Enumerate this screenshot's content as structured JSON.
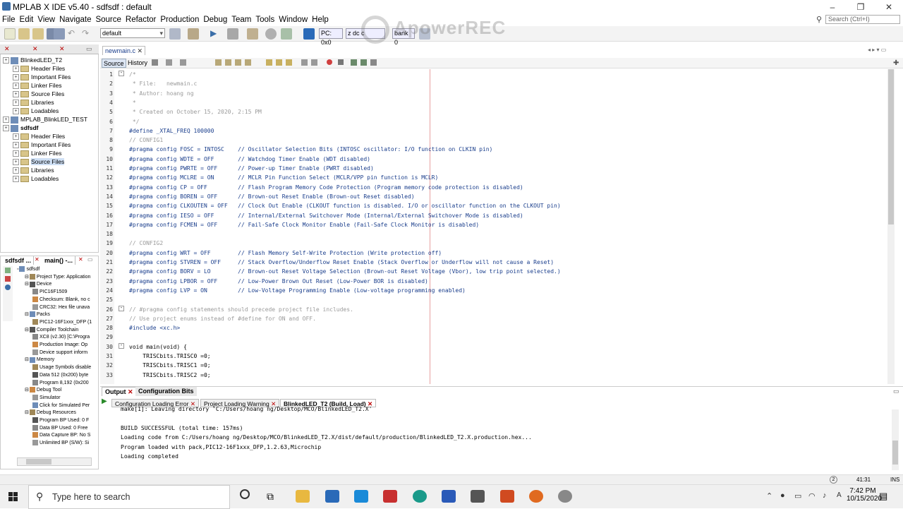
{
  "window": {
    "title": "MPLAB X IDE v5.40 - sdfsdf : default",
    "minimize": "–",
    "restore": "❐",
    "close": "✕"
  },
  "menu": [
    "File",
    "Edit",
    "View",
    "Navigate",
    "Source",
    "Refactor",
    "Production",
    "Debug",
    "Team",
    "Tools",
    "Window",
    "Help"
  ],
  "search": {
    "placeholder": "Search (Ctrl+I)"
  },
  "toolbar": {
    "config": "default",
    "pc": "PC: 0x0",
    "z": "z dc c",
    "bank": "bank 0",
    "watermark": "ApowerREC"
  },
  "projects": {
    "tabs": [
      "",
      "",
      ""
    ],
    "items": [
      {
        "label": "BlinkedLED_T2",
        "level": 0,
        "type": "project",
        "sel": false
      },
      {
        "label": "Header Files",
        "level": 1,
        "type": "folder"
      },
      {
        "label": "Important Files",
        "level": 1,
        "type": "folder"
      },
      {
        "label": "Linker Files",
        "level": 1,
        "type": "folder"
      },
      {
        "label": "Source Files",
        "level": 1,
        "type": "folder"
      },
      {
        "label": "Libraries",
        "level": 1,
        "type": "folder"
      },
      {
        "label": "Loadables",
        "level": 1,
        "type": "folder"
      },
      {
        "label": "MPLAB_BlinkLED_TEST",
        "level": 0,
        "type": "project"
      },
      {
        "label": "sdfsdf",
        "level": 0,
        "type": "project",
        "bold": true
      },
      {
        "label": "Header Files",
        "level": 1,
        "type": "folder"
      },
      {
        "label": "Important Files",
        "level": 1,
        "type": "folder"
      },
      {
        "label": "Linker Files",
        "level": 1,
        "type": "folder"
      },
      {
        "label": "Source Files",
        "level": 1,
        "type": "folder",
        "sel": true
      },
      {
        "label": "Libraries",
        "level": 1,
        "type": "folder"
      },
      {
        "label": "Loadables",
        "level": 1,
        "type": "folder"
      }
    ]
  },
  "dashboard": {
    "tabs": [
      "sdfsdf ...",
      "main() -..."
    ],
    "items": [
      {
        "label": "sdfsdf",
        "lvl": 0
      },
      {
        "label": "Project Type: Application",
        "lvl": 1
      },
      {
        "label": "Device",
        "lvl": 1
      },
      {
        "label": "PIC16F1509",
        "lvl": 2
      },
      {
        "label": "Checksum: Blank, no c",
        "lvl": 2
      },
      {
        "label": "CRC32: Hex file unava",
        "lvl": 2
      },
      {
        "label": "Packs",
        "lvl": 1
      },
      {
        "label": "PIC12-16F1xxx_DFP (1",
        "lvl": 2
      },
      {
        "label": "Compiler Toolchain",
        "lvl": 1
      },
      {
        "label": "XC8 (v2.30) [C:\\Progra",
        "lvl": 2
      },
      {
        "label": "Production Image: Op",
        "lvl": 2
      },
      {
        "label": "Device support inform",
        "lvl": 2
      },
      {
        "label": "Memory",
        "lvl": 1
      },
      {
        "label": "Usage Symbols disable",
        "lvl": 2
      },
      {
        "label": "Data 512 (0x200) byte",
        "lvl": 2
      },
      {
        "label": "Program 8,192 (0x200",
        "lvl": 2
      },
      {
        "label": "Debug Tool",
        "lvl": 1
      },
      {
        "label": "Simulator",
        "lvl": 2
      },
      {
        "label": "Click for Simulated Per",
        "lvl": 2
      },
      {
        "label": "Debug Resources",
        "lvl": 1
      },
      {
        "label": "Program BP Used: 0 F",
        "lvl": 2
      },
      {
        "label": "Data BP Used: 0  Free",
        "lvl": 2
      },
      {
        "label": "Data Capture BP: No S",
        "lvl": 2
      },
      {
        "label": "Unlimited BP (S/W): Si",
        "lvl": 2
      }
    ]
  },
  "editor": {
    "tab": "newmain.c",
    "close": "✕",
    "source_btn": "Source",
    "history_btn": "History",
    "lines": [
      {
        "n": "1",
        "t": "/*",
        "c": "cm",
        "fold": true
      },
      {
        "n": "2",
        "t": " * File:   newmain.c",
        "c": "cm"
      },
      {
        "n": "3",
        "t": " * Author: hoang ng",
        "c": "cm"
      },
      {
        "n": "4",
        "t": " *",
        "c": "cm"
      },
      {
        "n": "5",
        "t": " * Created on October 15, 2020, 2:15 PM",
        "c": "cm"
      },
      {
        "n": "6",
        "t": " */",
        "c": "cm"
      },
      {
        "n": "7",
        "t": "#define _XTAL_FREQ 100000",
        "c": ""
      },
      {
        "n": "8",
        "t": "// CONFIG1",
        "c": "cm"
      },
      {
        "n": "9",
        "t": "#pragma config FOSC = INTOSC    // Oscillator Selection Bits (INTOSC oscillator: I/O function on CLKIN pin)",
        "c": ""
      },
      {
        "n": "10",
        "t": "#pragma config WDTE = OFF       // Watchdog Timer Enable (WDT disabled)",
        "c": ""
      },
      {
        "n": "11",
        "t": "#pragma config PWRTE = OFF      // Power-up Timer Enable (PWRT disabled)",
        "c": ""
      },
      {
        "n": "12",
        "t": "#pragma config MCLRE = ON       // MCLR Pin Function Select (MCLR/VPP pin function is MCLR)",
        "c": ""
      },
      {
        "n": "13",
        "t": "#pragma config CP = OFF         // Flash Program Memory Code Protection (Program memory code protection is disabled)",
        "c": ""
      },
      {
        "n": "14",
        "t": "#pragma config BOREN = OFF      // Brown-out Reset Enable (Brown-out Reset disabled)",
        "c": ""
      },
      {
        "n": "15",
        "t": "#pragma config CLKOUTEN = OFF   // Clock Out Enable (CLKOUT function is disabled. I/O or oscillator function on the CLKOUT pin)",
        "c": ""
      },
      {
        "n": "16",
        "t": "#pragma config IESO = OFF       // Internal/External Switchover Mode (Internal/External Switchover Mode is disabled)",
        "c": ""
      },
      {
        "n": "17",
        "t": "#pragma config FCMEN = OFF      // Fail-Safe Clock Monitor Enable (Fail-Safe Clock Monitor is disabled)",
        "c": ""
      },
      {
        "n": "18",
        "t": "",
        "c": ""
      },
      {
        "n": "19",
        "t": "// CONFIG2",
        "c": "cm"
      },
      {
        "n": "20",
        "t": "#pragma config WRT = OFF        // Flash Memory Self-Write Protection (Write protection off)",
        "c": ""
      },
      {
        "n": "21",
        "t": "#pragma config STVREN = OFF     // Stack Overflow/Underflow Reset Enable (Stack Overflow or Underflow will not cause a Reset)",
        "c": ""
      },
      {
        "n": "22",
        "t": "#pragma config BORV = LO        // Brown-out Reset Voltage Selection (Brown-out Reset Voltage (Vbor), low trip point selected.)",
        "c": ""
      },
      {
        "n": "23",
        "t": "#pragma config LPBOR = OFF      // Low-Power Brown Out Reset (Low-Power BOR is disabled)",
        "c": ""
      },
      {
        "n": "24",
        "t": "#pragma config LVP = ON         // Low-Voltage Programming Enable (Low-voltage programming enabled)",
        "c": ""
      },
      {
        "n": "25",
        "t": "",
        "c": ""
      },
      {
        "n": "26",
        "t": "// #pragma config statements should precede project file includes.",
        "c": "cm",
        "fold": true
      },
      {
        "n": "27",
        "t": "// Use project enums instead of #define for ON and OFF.",
        "c": "cm"
      },
      {
        "n": "28",
        "t": "#include <xc.h>",
        "c": ""
      },
      {
        "n": "29",
        "t": "",
        "c": ""
      },
      {
        "n": "30",
        "t": "void main(void) {",
        "c": "",
        "fold": true
      },
      {
        "n": "31",
        "t": "    TRISCbits.TRISC0 =0;",
        "c": ""
      },
      {
        "n": "32",
        "t": "    TRISCbits.TRISC1 =0;",
        "c": ""
      },
      {
        "n": "33",
        "t": "    TRISCbits.TRISC2 =0;",
        "c": ""
      }
    ]
  },
  "output": {
    "tabs": [
      "Output",
      "Configuration Bits"
    ],
    "subtabs": [
      "Configuration Loading Error",
      "Project Loading Warning",
      "BlinkedLED_T2 (Build, Load)"
    ],
    "lines": [
      "make[1]: Leaving directory 'C:/Users/hoang ng/Desktop/MCO/BlinkedLED_T2.X'",
      "",
      "BUILD SUCCESSFUL (total time: 157ms)",
      "Loading code from C:/Users/hoang ng/Desktop/MCO/BlinkedLED_T2.X/dist/default/production/BlinkedLED_T2.X.production.hex...",
      "Program loaded with pack,PIC12-16F1xxx_DFP,1.2.63,Microchip",
      "Loading completed"
    ]
  },
  "status": {
    "pos": "41:31",
    "mode": "INS",
    "badge": "2"
  },
  "taskbar": {
    "search": "Type here to search",
    "time": "7:42 PM",
    "date": "10/15/2020"
  },
  "colors": {
    "accent": "#1a3e8c",
    "comment": "#9a9a9a",
    "margin": "#e8a0a0"
  }
}
